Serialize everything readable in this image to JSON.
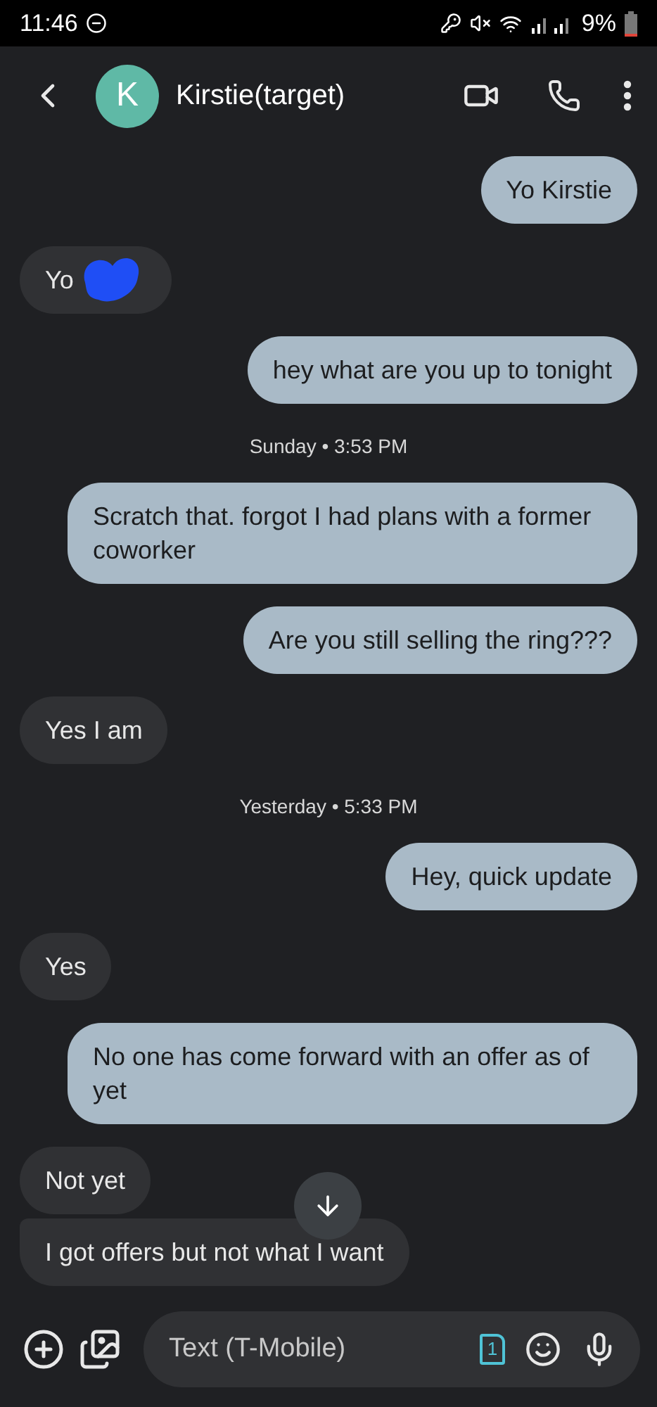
{
  "status_bar": {
    "time": "11:46",
    "battery": "9%"
  },
  "header": {
    "avatar_letter": "K",
    "contact": "Kirstie(target)"
  },
  "messages": [
    {
      "kind": "out",
      "text": "Yo Kirstie"
    },
    {
      "kind": "in",
      "text": "Yo",
      "redacted": true
    },
    {
      "kind": "out",
      "text": "hey what are you up to tonight"
    },
    {
      "kind": "date",
      "text": "Sunday • 3:53 PM"
    },
    {
      "kind": "out",
      "text": "Scratch that. forgot I had plans with a former coworker"
    },
    {
      "kind": "out",
      "text": "Are you still selling the ring???"
    },
    {
      "kind": "in",
      "text": "Yes I am"
    },
    {
      "kind": "date",
      "text": "Yesterday • 5:33 PM"
    },
    {
      "kind": "out",
      "text": "Hey, quick update"
    },
    {
      "kind": "in",
      "text": "Yes"
    },
    {
      "kind": "out",
      "text": "No one has come forward with an offer as of yet"
    },
    {
      "kind": "in",
      "text": "Not yet"
    },
    {
      "kind": "in",
      "text": "I got offers but not what I want",
      "grouped": true
    }
  ],
  "composer": {
    "placeholder": "Text (T-Mobile)",
    "sim_label": "1"
  }
}
